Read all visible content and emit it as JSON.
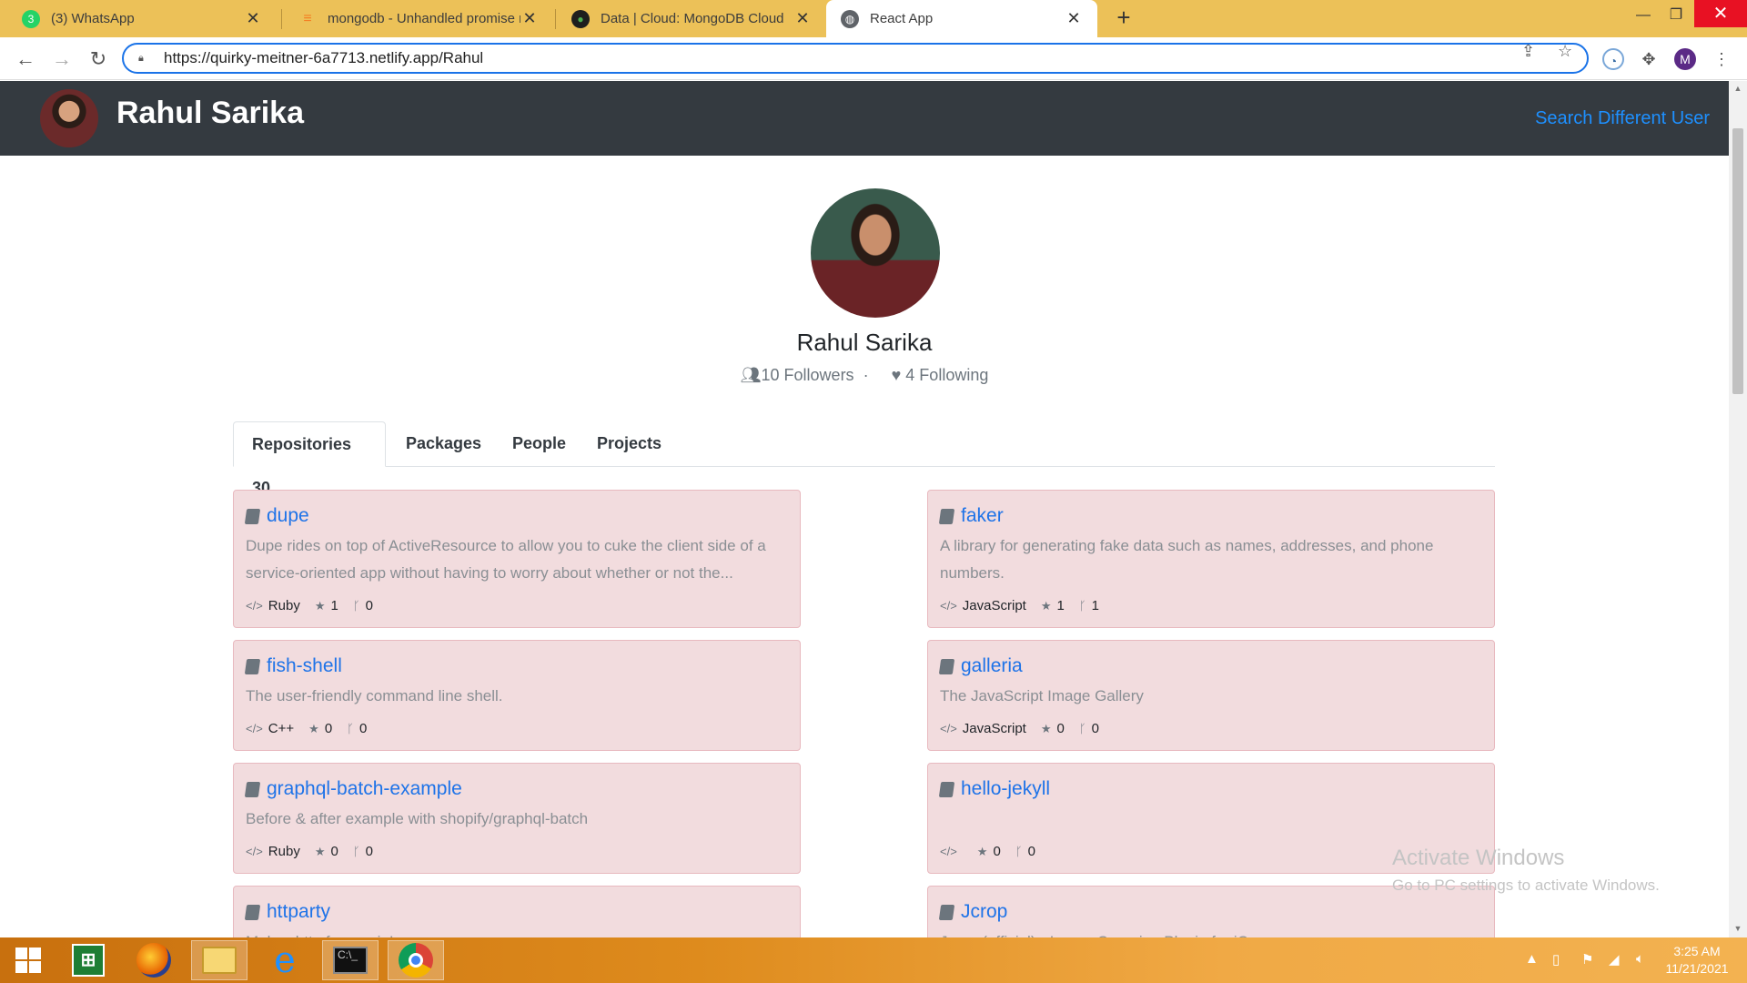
{
  "browser": {
    "tabs": [
      {
        "title": "(3) WhatsApp",
        "icon": "whatsapp-icon"
      },
      {
        "title": "mongodb - Unhandled promise r",
        "icon": "stackoverflow-icon"
      },
      {
        "title": "Data | Cloud: MongoDB Cloud",
        "icon": "mongodb-leaf-icon"
      },
      {
        "title": "React App",
        "icon": "globe-icon"
      }
    ],
    "whatsapp_badge": "3",
    "url": "https://quirky-meitner-6a7713.netlify.app/Rahul",
    "profile_initial": "M",
    "accent": "#ecc158"
  },
  "app": {
    "header_name": "Rahul Sarika",
    "search_link": "Search Different User",
    "profile_name": "Rahul Sarika",
    "followers": "10 Followers",
    "following": "4 Following",
    "tabs": [
      "Repositories 30",
      "Packages",
      "People",
      "Projects"
    ],
    "repos": [
      {
        "name": "dupe",
        "description": "Dupe rides on top of ActiveResource to allow you to cuke the client side of a service-oriented app without having to worry about whether or not the...",
        "language": "Ruby",
        "stars": "1",
        "forks": "0"
      },
      {
        "name": "faker",
        "description": "A library for generating fake data such as names, addresses, and phone numbers.",
        "language": "JavaScript",
        "stars": "1",
        "forks": "1"
      },
      {
        "name": "fish-shell",
        "description": "The user-friendly command line shell.",
        "language": "C++",
        "stars": "0",
        "forks": "0"
      },
      {
        "name": "galleria",
        "description": "The JavaScript Image Gallery",
        "language": "JavaScript",
        "stars": "0",
        "forks": "0"
      },
      {
        "name": "graphql-batch-example",
        "description": "Before & after example with shopify/graphql-batch",
        "language": "Ruby",
        "stars": "0",
        "forks": "0"
      },
      {
        "name": "hello-jekyll",
        "description": "",
        "language": "",
        "stars": "0",
        "forks": "0"
      },
      {
        "name": "httparty",
        "description": "Makes http fun again!",
        "language": "",
        "stars": "",
        "forks": ""
      },
      {
        "name": "Jcrop",
        "description": "Jcrop (official) - Image Cropping Plugin for jQuery",
        "language": "",
        "stars": "",
        "forks": ""
      }
    ],
    "card_bg": "#f2dcde",
    "link_color": "#1e73e8"
  },
  "watermark": {
    "line1": "Activate Windows",
    "line2": "Go to PC settings to activate Windows."
  },
  "taskbar": {
    "time": "3:25 AM",
    "date": "11/21/2021"
  }
}
